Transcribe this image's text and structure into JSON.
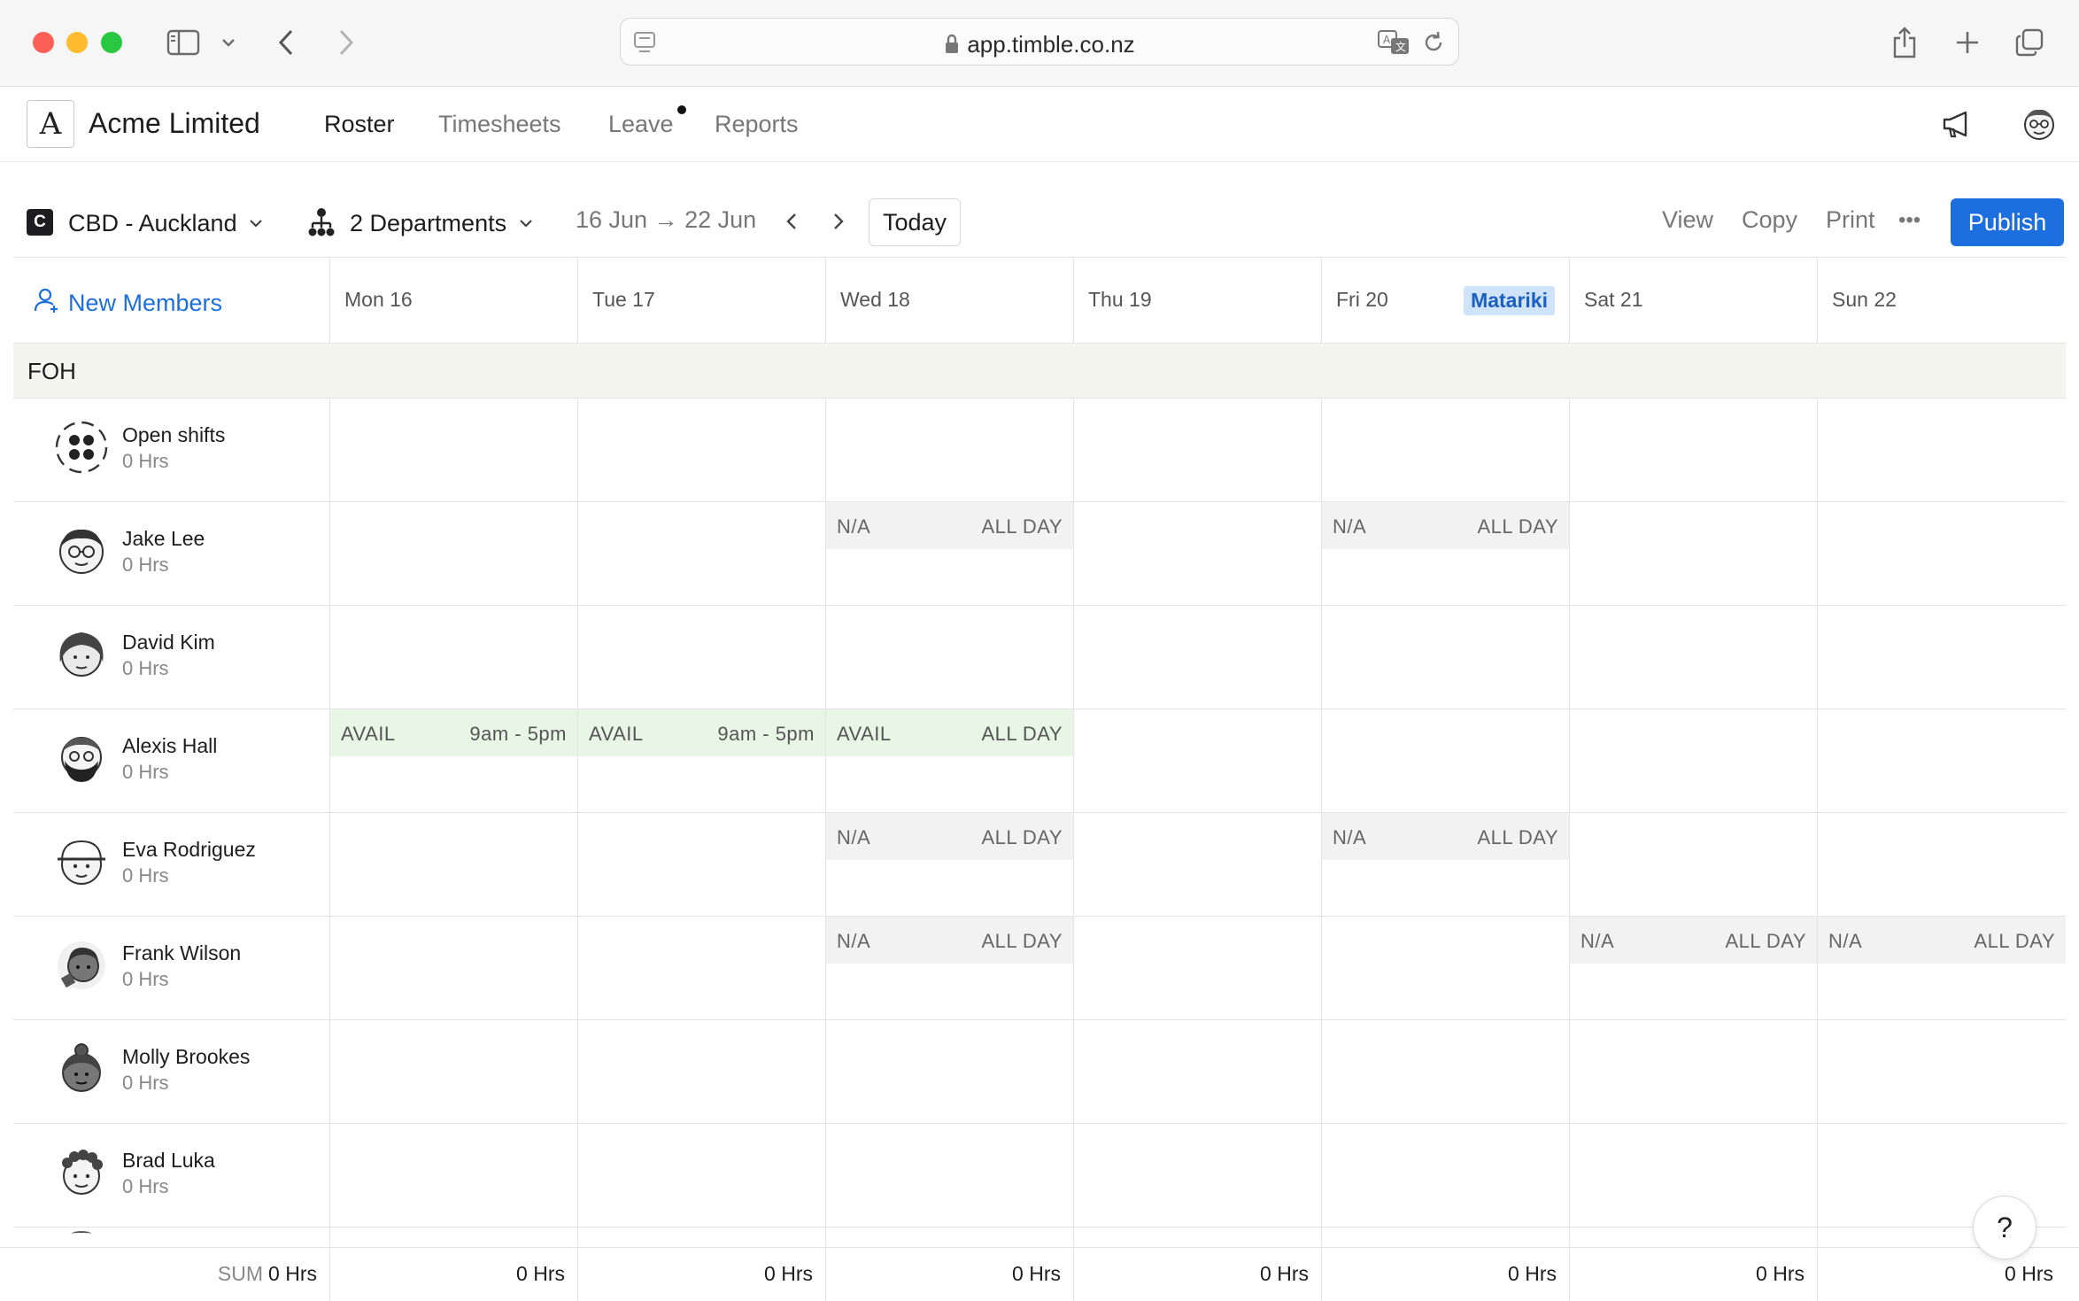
{
  "browser": {
    "url": "app.timble.co.nz"
  },
  "app": {
    "logo_letter": "A",
    "company": "Acme Limited",
    "nav": [
      {
        "label": "Roster",
        "active": true
      },
      {
        "label": "Timesheets",
        "active": false
      },
      {
        "label": "Leave",
        "active": false,
        "has_dot": true
      },
      {
        "label": "Reports",
        "active": false
      }
    ]
  },
  "toolbar": {
    "location_initial": "C",
    "location": "CBD - Auckland",
    "departments": "2 Departments",
    "date_range": "16 Jun → 22 Jun",
    "today_label": "Today",
    "view_label": "View",
    "copy_label": "Copy",
    "print_label": "Print",
    "more_label": "•••",
    "publish_label": "Publish"
  },
  "grid": {
    "new_members_label": "New Members",
    "days": [
      {
        "label": "Mon 16",
        "holiday": ""
      },
      {
        "label": "Tue 17",
        "holiday": ""
      },
      {
        "label": "Wed 18",
        "holiday": ""
      },
      {
        "label": "Thu 19",
        "holiday": ""
      },
      {
        "label": "Fri 20",
        "holiday": "Matariki"
      },
      {
        "label": "Sat 21",
        "holiday": ""
      },
      {
        "label": "Sun 22",
        "holiday": ""
      }
    ],
    "section": "FOH",
    "members": [
      {
        "name": "Open shifts",
        "hours": "0 Hrs",
        "avatar": "open-shifts-icon",
        "cells": [
          "",
          "",
          "",
          "",
          "",
          "",
          ""
        ]
      },
      {
        "name": "Jake Lee",
        "hours": "0 Hrs",
        "avatar": "avatar-glasses",
        "cells": [
          "",
          "",
          "na",
          "",
          "na",
          "",
          ""
        ]
      },
      {
        "name": "David Kim",
        "hours": "0 Hrs",
        "avatar": "avatar-hair",
        "cells": [
          "",
          "",
          "",
          "",
          "",
          "",
          ""
        ]
      },
      {
        "name": "Alexis Hall",
        "hours": "0 Hrs",
        "avatar": "avatar-beard",
        "cells": [
          "avail-9to5",
          "avail-9to5",
          "avail-allday",
          "",
          "",
          "",
          ""
        ]
      },
      {
        "name": "Eva Rodriguez",
        "hours": "0 Hrs",
        "avatar": "avatar-cap",
        "cells": [
          "",
          "",
          "na",
          "",
          "na",
          "",
          ""
        ]
      },
      {
        "name": "Frank Wilson",
        "hours": "0 Hrs",
        "avatar": "avatar-dark",
        "cells": [
          "",
          "",
          "na",
          "",
          "",
          "na",
          "na"
        ]
      },
      {
        "name": "Molly Brookes",
        "hours": "0 Hrs",
        "avatar": "avatar-bun",
        "cells": [
          "",
          "",
          "",
          "",
          "",
          "",
          ""
        ]
      },
      {
        "name": "Brad Luka",
        "hours": "0 Hrs",
        "avatar": "avatar-curly",
        "cells": [
          "",
          "",
          "",
          "",
          "",
          "",
          ""
        ]
      }
    ],
    "chip_text": {
      "na": "N/A",
      "avail": "AVAIL",
      "all_day": "ALL DAY",
      "time_9to5": "9am - 5pm"
    }
  },
  "footer": {
    "sum_label": "SUM",
    "total": "0 Hrs",
    "day_totals": [
      "0 Hrs",
      "0 Hrs",
      "0 Hrs",
      "0 Hrs",
      "0 Hrs",
      "0 Hrs",
      "0 Hrs"
    ]
  },
  "help_label": "?",
  "colors": {
    "accent": "#1d6fdf",
    "holiday_bg": "#cfe3fb",
    "avail_bg": "#e8f6e6",
    "na_bg": "#f2f2f2",
    "section_bg": "#f5f5f0"
  }
}
